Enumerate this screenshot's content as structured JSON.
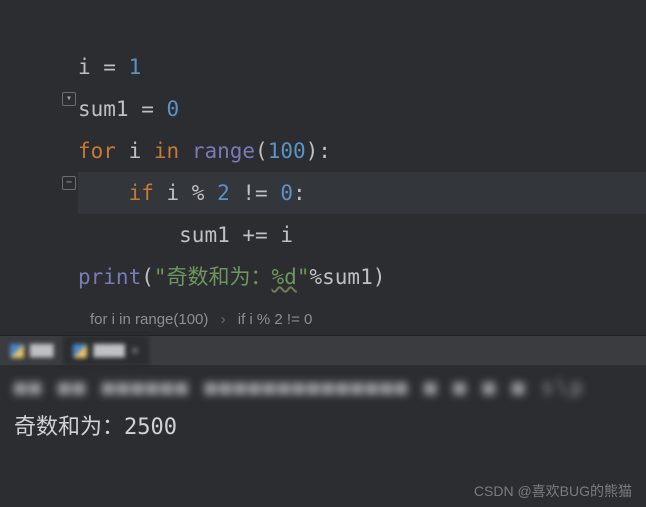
{
  "code": {
    "line1": {
      "var": "i",
      "op": " = ",
      "val": "1"
    },
    "line2": {
      "var": "sum1",
      "op": " = ",
      "val": "0"
    },
    "line3": {
      "kw1": "for ",
      "var": "i",
      "kw2": " in ",
      "fn": "range",
      "open": "(",
      "arg": "100",
      "close": "):"
    },
    "line4": {
      "kw": "if ",
      "expr1": "i % ",
      "num1": "2",
      "expr2": " != ",
      "num2": "0",
      "colon": ":"
    },
    "line5": {
      "var": "sum1",
      "op": " += ",
      "rhs": "i"
    },
    "line6": {
      "fn": "print",
      "open": "(",
      "str1": "\"奇数和为：",
      "fmt": "%d",
      "str2": "\"",
      "pct": "%",
      "var": "sum1",
      "close": ")"
    }
  },
  "folds": {
    "for": "▾",
    "if": "−"
  },
  "breadcrumb": {
    "item1": "for i in range(100)",
    "sep": "›",
    "item2": "if i % 2 != 0"
  },
  "tabs": {
    "tab1": "▇▇▇",
    "tab2": "▇▇▇▇",
    "close": "×"
  },
  "console": {
    "path": "■■ ■■ ■■■■■■ ■■■■■■■■■■■■■■   ■ ■ ■ ■ s\\p",
    "output": "奇数和为：2500"
  },
  "watermark": "CSDN @喜欢BUG的熊猫"
}
